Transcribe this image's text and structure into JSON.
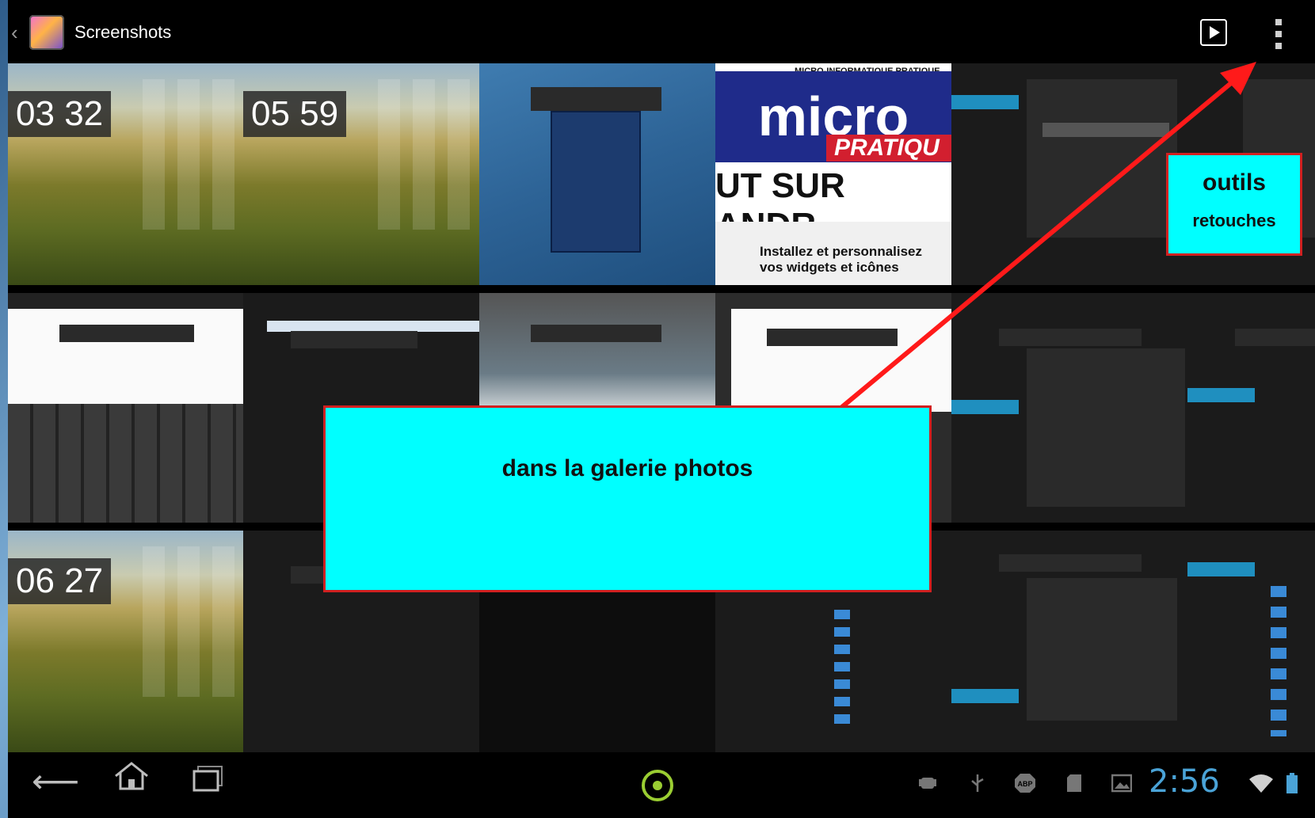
{
  "actionbar": {
    "title": "Screenshots",
    "icons": [
      "up-caret-icon",
      "gallery-app-icon",
      "slideshow-icon",
      "overflow-menu-icon"
    ]
  },
  "thumbnails": {
    "home1_time": [
      "03",
      "32"
    ],
    "home2_time": [
      "05",
      "59"
    ],
    "home3_time": [
      "06",
      "27"
    ],
    "magazine_top": "MICRO-INFORMATIQUE PRATIQUE",
    "magazine_masthead": "micro",
    "magazine_pratique": "PRATIQU",
    "magazine_headline": "UT SUR ANDR",
    "magazine_sub": "Installez et personnalisez vos widgets et icônes"
  },
  "callouts": {
    "main": "dans la galerie photos",
    "tools_line1": "outils",
    "tools_line2": "retouches"
  },
  "navbar": {
    "time": "2:56",
    "icons": [
      "back-icon",
      "home-icon",
      "recent-apps-icon",
      "launcher-icon",
      "android-debug-icon",
      "usb-icon",
      "abp-icon",
      "sd-card-icon",
      "picture-icon",
      "wifi-icon",
      "battery-icon"
    ]
  },
  "colors": {
    "callout_fill": "#00ffff",
    "callout_border": "#d02020",
    "arrow": "#ff1a1a",
    "clock": "#4aa3d7",
    "launcher": "#9acd32"
  }
}
